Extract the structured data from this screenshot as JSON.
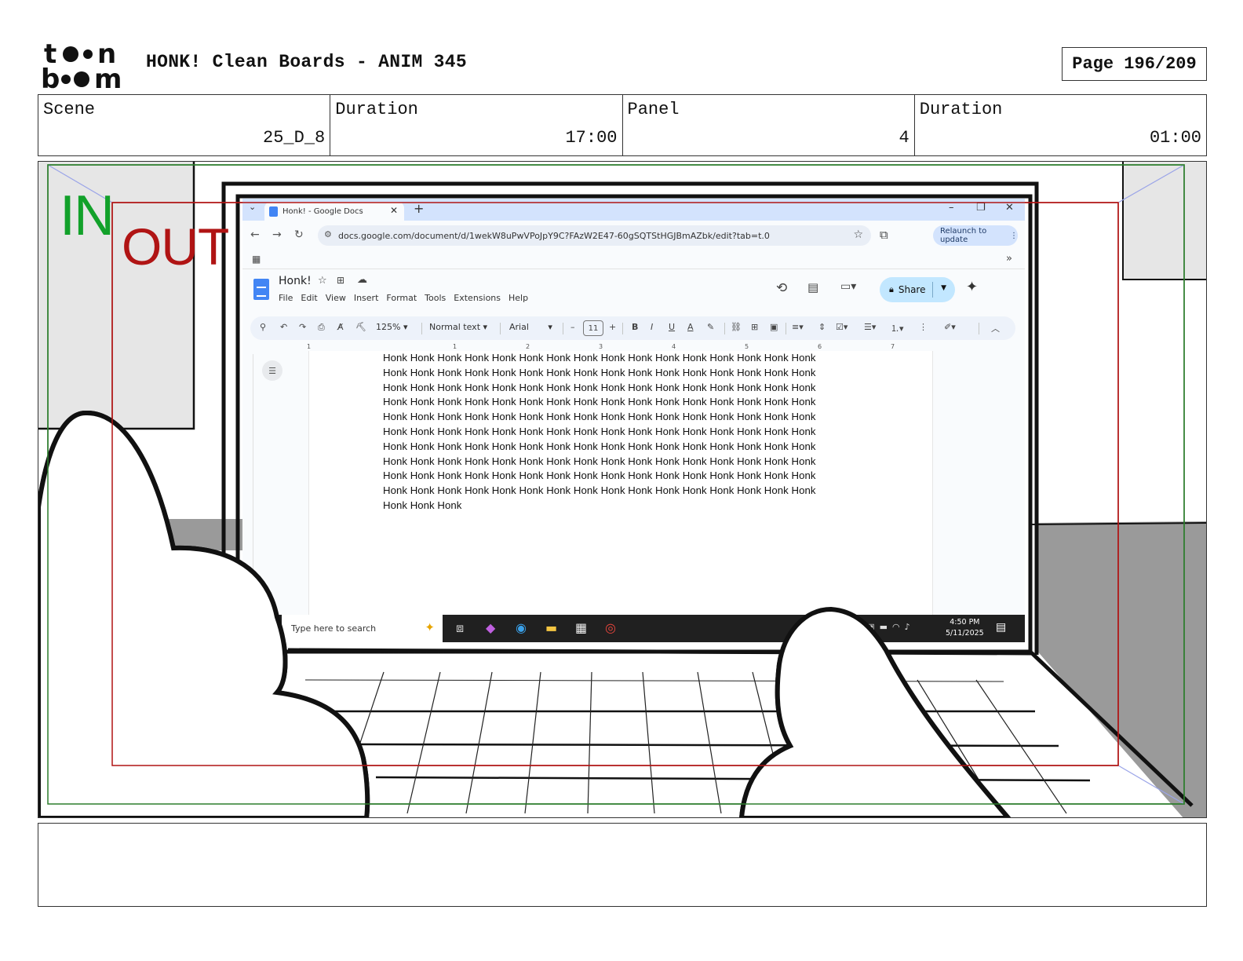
{
  "header": {
    "title": "HONK! Clean Boards - ANIM 345",
    "page": "Page 196/209",
    "logo_text": "toon boom"
  },
  "info": {
    "scene_label": "Scene",
    "scene_value": "25_D_8",
    "duration_label": "Duration",
    "duration_value": "17:00",
    "panel_label": "Panel",
    "panel_value": "4",
    "panel_duration_label": "Duration",
    "panel_duration_value": "01:00"
  },
  "frame_labels": {
    "in": "IN",
    "out": "OUT"
  },
  "browser": {
    "tab_title": "Honk! - Google Docs",
    "url": "docs.google.com/document/d/1wekW8uPwVPoJpY9C?FAzW2E47-60gSQTStHGJBmAZbk/edit?tab=t.0",
    "relaunch": "Relaunch to update"
  },
  "docs": {
    "name": "Honk!",
    "menu": [
      "File",
      "Edit",
      "View",
      "Insert",
      "Format",
      "Tools",
      "Extensions",
      "Help"
    ],
    "share": "Share",
    "zoom": "125%",
    "style": "Normal text",
    "font": "Arial",
    "size": "11",
    "ruler": [
      "1",
      "1",
      "2",
      "3",
      "4",
      "5",
      "6",
      "7"
    ],
    "body_lines": [
      "Honk Honk Honk Honk Honk Honk Honk Honk Honk Honk Honk Honk Honk Honk Honk Honk",
      "Honk Honk Honk Honk Honk Honk Honk Honk Honk Honk Honk Honk Honk Honk Honk Honk",
      "Honk Honk Honk Honk Honk Honk Honk Honk Honk Honk Honk Honk Honk Honk Honk Honk",
      "Honk Honk Honk Honk Honk Honk Honk Honk Honk Honk Honk Honk Honk Honk Honk Honk",
      "Honk Honk Honk Honk Honk Honk Honk Honk Honk Honk Honk Honk Honk Honk Honk Honk",
      "Honk Honk Honk Honk Honk Honk Honk Honk Honk Honk Honk Honk Honk Honk Honk Honk",
      "Honk Honk Honk Honk Honk Honk Honk Honk Honk Honk Honk Honk Honk Honk Honk Honk",
      "Honk Honk Honk Honk Honk Honk Honk Honk Honk Honk Honk Honk Honk Honk Honk Honk",
      "Honk Honk Honk Honk Honk Honk Honk Honk Honk Honk Honk Honk Honk Honk Honk Honk",
      "Honk Honk Honk Honk Honk Honk Honk Honk Honk Honk Honk Honk Honk Honk Honk Honk",
      "Honk Honk Honk"
    ]
  },
  "taskbar": {
    "search_placeholder": "Type here to search",
    "time": "4:50 PM",
    "date": "5/11/2025"
  },
  "colors": {
    "in_frame": "#12a12a",
    "out_frame": "#b01414",
    "share_button": "#c2e7ff",
    "tabbar": "#d3e3fd"
  },
  "icons": [
    "doc-icon",
    "close-icon",
    "plus-icon",
    "back-icon",
    "forward-icon",
    "reload-icon",
    "star-icon",
    "extensions-icon",
    "apps-icon",
    "history-icon",
    "comment-icon",
    "meet-icon",
    "lock-icon",
    "gemini-icon",
    "search-icon",
    "undo-icon",
    "redo-icon",
    "print-icon",
    "spellcheck-icon",
    "paint-format-icon",
    "bold-icon",
    "italic-icon",
    "underline-icon",
    "text-color-icon",
    "highlight-icon",
    "link-icon",
    "comment-add-icon",
    "image-icon",
    "align-icon",
    "line-spacing-icon",
    "checklist-icon",
    "bullet-list-icon",
    "numbered-list-icon",
    "more-icon",
    "edit-mode-icon",
    "collapse-icon",
    "outline-icon",
    "windows-search-icon",
    "task-view-icon",
    "copilot-icon",
    "edge-icon",
    "file-explorer-icon",
    "store-icon",
    "chrome-icon",
    "notification-icon"
  ]
}
